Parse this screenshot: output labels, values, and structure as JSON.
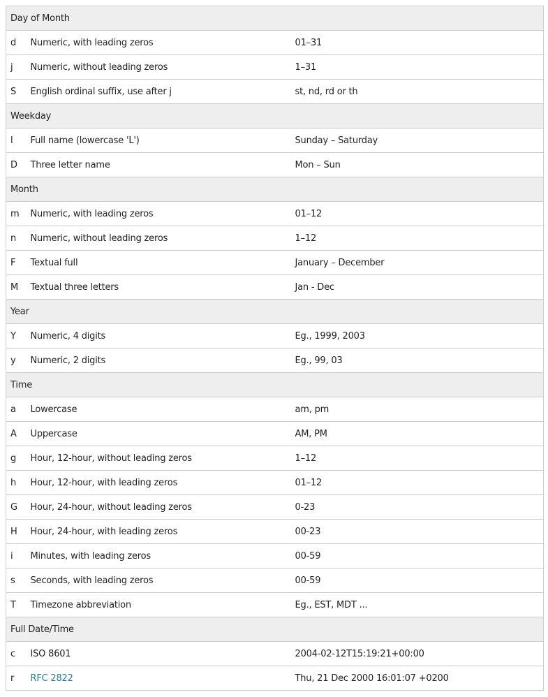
{
  "groups": [
    {
      "title": "Day of Month",
      "rows": [
        {
          "char": "d",
          "desc": "Numeric, with leading zeros",
          "example": "01–31"
        },
        {
          "char": "j",
          "desc": "Numeric, without leading zeros",
          "example": "1–31"
        },
        {
          "char": "S",
          "desc": "English ordinal suffix, use after j",
          "example": "st, nd, rd or th"
        }
      ]
    },
    {
      "title": "Weekday",
      "rows": [
        {
          "char": "l",
          "desc": "Full name  (lowercase 'L')",
          "example": "Sunday – Saturday"
        },
        {
          "char": "D",
          "desc": "Three letter name",
          "example": "Mon – Sun"
        }
      ]
    },
    {
      "title": "Month",
      "rows": [
        {
          "char": "m",
          "desc": "Numeric, with leading zeros",
          "example": "01–12"
        },
        {
          "char": "n",
          "desc": "Numeric, without leading zeros",
          "example": "1–12"
        },
        {
          "char": "F",
          "desc": "Textual full",
          "example": "January – December"
        },
        {
          "char": "M",
          "desc": "Textual three letters",
          "example": "Jan - Dec"
        }
      ]
    },
    {
      "title": "Year",
      "rows": [
        {
          "char": "Y",
          "desc": "Numeric, 4 digits",
          "example": "Eg., 1999, 2003"
        },
        {
          "char": "y",
          "desc": "Numeric, 2 digits",
          "example": "Eg., 99, 03"
        }
      ]
    },
    {
      "title": "Time",
      "rows": [
        {
          "char": "a",
          "desc": "Lowercase",
          "example": "am, pm"
        },
        {
          "char": "A",
          "desc": "Uppercase",
          "example": "AM, PM"
        },
        {
          "char": "g",
          "desc": "Hour, 12-hour, without leading zeros",
          "example": "1–12"
        },
        {
          "char": "h",
          "desc": "Hour, 12-hour, with leading zeros",
          "example": "01–12"
        },
        {
          "char": "G",
          "desc": "Hour, 24-hour, without leading zeros",
          "example": "0-23"
        },
        {
          "char": "H",
          "desc": "Hour, 24-hour, with leading zeros",
          "example": "00-23"
        },
        {
          "char": "i",
          "desc": "Minutes, with leading zeros",
          "example": "00-59"
        },
        {
          "char": "s",
          "desc": "Seconds, with leading zeros",
          "example": "00-59"
        },
        {
          "char": "T",
          "desc": "Timezone abbreviation",
          "example": "Eg., EST, MDT ..."
        }
      ]
    },
    {
      "title": "Full Date/Time",
      "rows": [
        {
          "char": "c",
          "desc": "ISO 8601",
          "example": "2004-02-12T15:19:21+00:00"
        },
        {
          "char": "r",
          "desc": "RFC 2822",
          "example": "Thu, 21 Dec 2000 16:01:07 +0200",
          "desc_is_link": true
        }
      ]
    }
  ],
  "colors": {
    "link": "#2a7a94",
    "group_bg": "#eeeeee",
    "border": "#cccccc"
  }
}
